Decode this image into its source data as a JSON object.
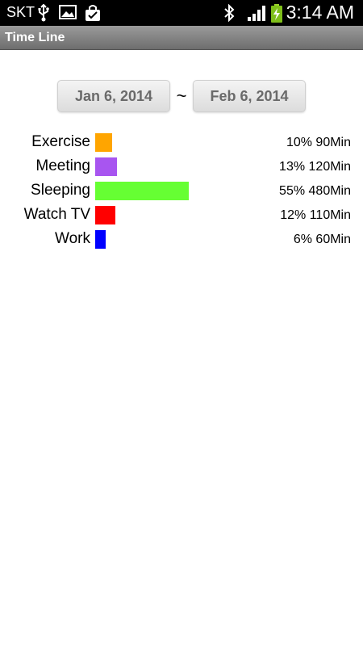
{
  "status_bar": {
    "carrier": "SKT",
    "clock": "3:14 AM",
    "icons": [
      "usb-icon",
      "image-icon",
      "shopping-bag-icon",
      "bluetooth-icon",
      "signal-icon",
      "battery-charging-icon"
    ]
  },
  "title_bar": {
    "title": "Time Line"
  },
  "date_range": {
    "start": "Jan 6, 2014",
    "separator": "~",
    "end": "Feb 6, 2014"
  },
  "activities": [
    {
      "label": "Exercise",
      "percent": 10,
      "stat": "10% 90Min",
      "color": "#FFA500"
    },
    {
      "label": "Meeting",
      "percent": 13,
      "stat": "13% 120Min",
      "color": "#A855F0"
    },
    {
      "label": "Sleeping",
      "percent": 55,
      "stat": "55% 480Min",
      "color": "#66FF33"
    },
    {
      "label": "Watch TV",
      "percent": 12,
      "stat": "12% 110Min",
      "color": "#FF0000"
    },
    {
      "label": "Work",
      "percent": 6,
      "stat": "6% 60Min",
      "color": "#0000FF"
    }
  ]
}
